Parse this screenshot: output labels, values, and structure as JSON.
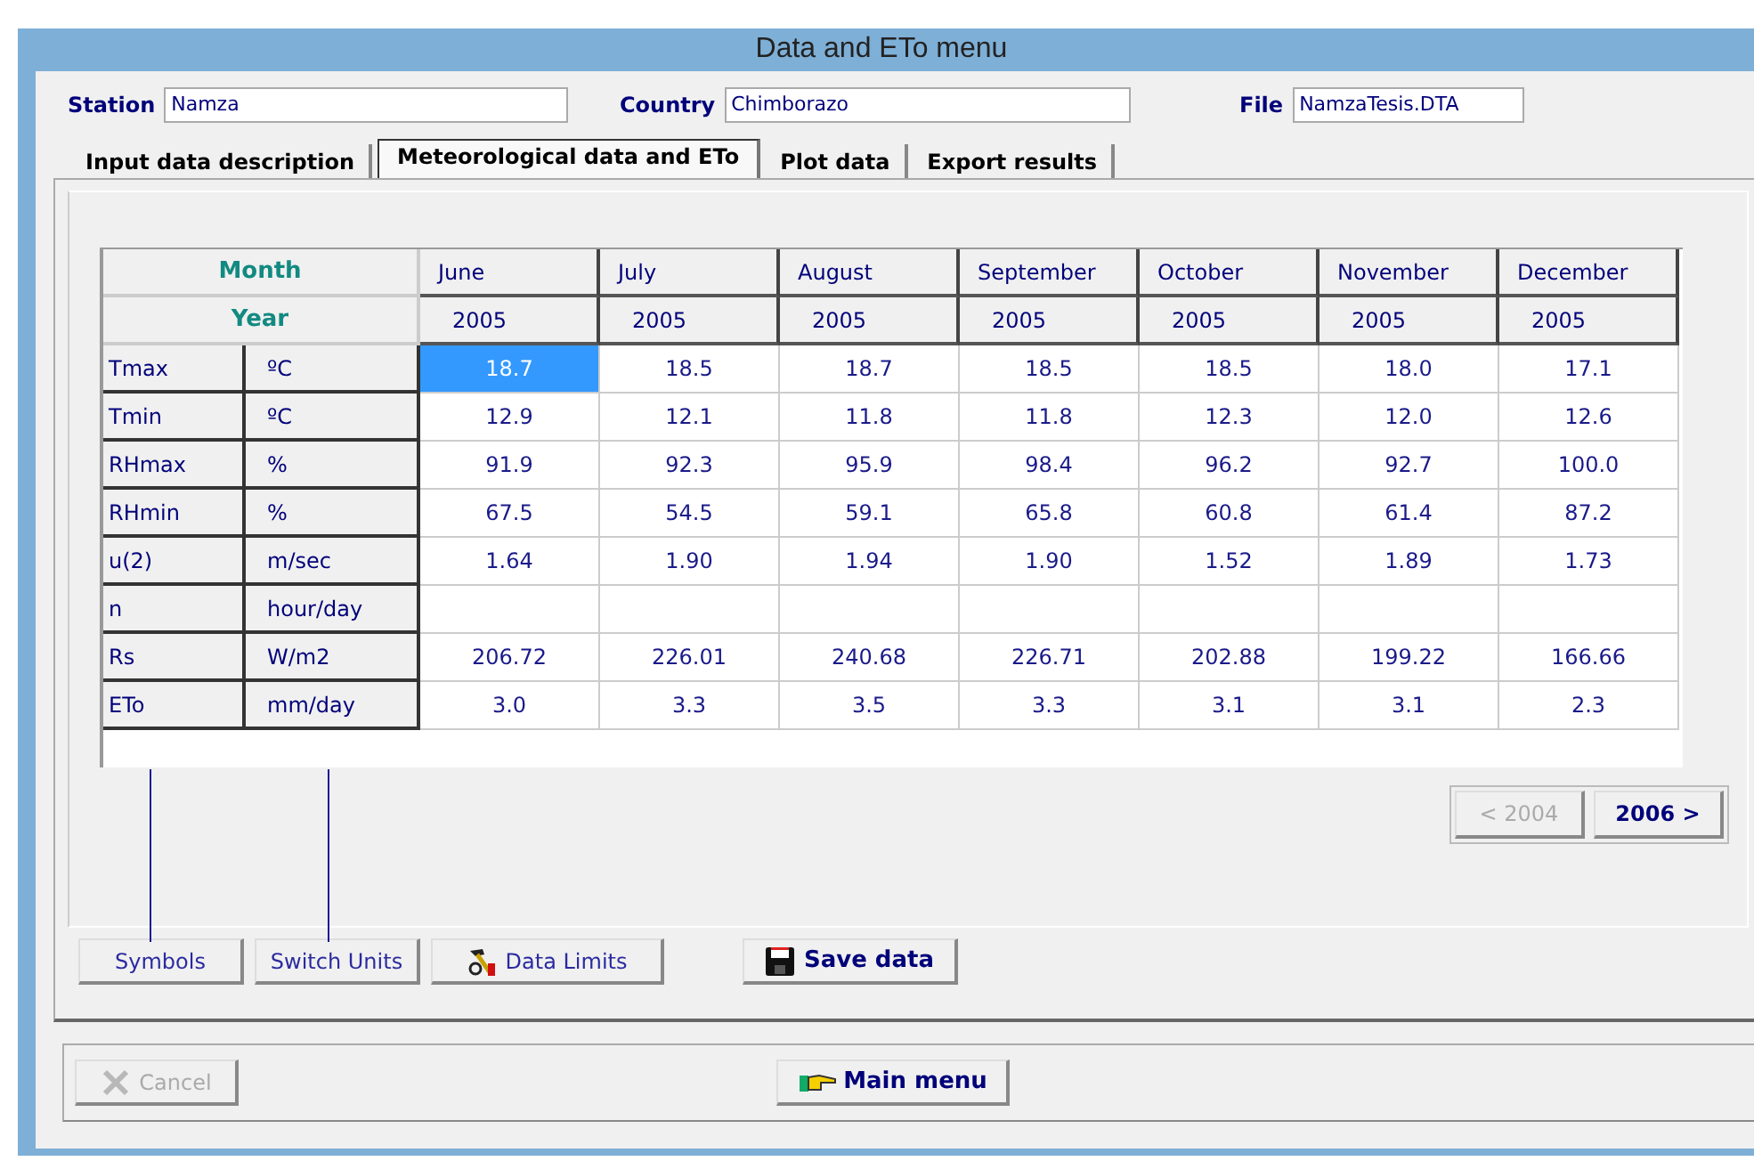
{
  "window": {
    "title": "Data and ETo menu"
  },
  "fields": [
    {
      "label": "Station",
      "value": "Namza"
    },
    {
      "label": "Country",
      "value": "Chimborazo"
    },
    {
      "label": "File",
      "value": "NamzaTesis.DTA"
    }
  ],
  "tabs": [
    {
      "label": "Input data description",
      "selected": false
    },
    {
      "label": "Meteorological data and ETo",
      "selected": true
    },
    {
      "label": "Plot data",
      "selected": false
    },
    {
      "label": "Export results",
      "selected": false
    }
  ],
  "table": {
    "month_label": "Month",
    "year_label": "Year",
    "columns": [
      {
        "month": "June",
        "year": "2005"
      },
      {
        "month": "July",
        "year": "2005"
      },
      {
        "month": "August",
        "year": "2005"
      },
      {
        "month": "September",
        "year": "2005"
      },
      {
        "month": "October",
        "year": "2005"
      },
      {
        "month": "November",
        "year": "2005"
      },
      {
        "month": "December",
        "year": "2005"
      }
    ],
    "rows": [
      {
        "variable": "Tmax",
        "unit": "ºC",
        "cells": [
          {
            "value": "18.7",
            "selected": true
          },
          {
            "value": "18.5",
            "selected": false
          },
          {
            "value": "18.7",
            "selected": false
          },
          {
            "value": "18.5",
            "selected": false
          },
          {
            "value": "18.5",
            "selected": false
          },
          {
            "value": "18.0",
            "selected": false
          },
          {
            "value": "17.1",
            "selected": false
          }
        ]
      },
      {
        "variable": "Tmin",
        "unit": "ºC",
        "cells": [
          {
            "value": "12.9",
            "selected": false
          },
          {
            "value": "12.1",
            "selected": false
          },
          {
            "value": "11.8",
            "selected": false
          },
          {
            "value": "11.8",
            "selected": false
          },
          {
            "value": "12.3",
            "selected": false
          },
          {
            "value": "12.0",
            "selected": false
          },
          {
            "value": "12.6",
            "selected": false
          }
        ]
      },
      {
        "variable": "RHmax",
        "unit": "%",
        "cells": [
          {
            "value": "91.9",
            "selected": false
          },
          {
            "value": "92.3",
            "selected": false
          },
          {
            "value": "95.9",
            "selected": false
          },
          {
            "value": "98.4",
            "selected": false
          },
          {
            "value": "96.2",
            "selected": false
          },
          {
            "value": "92.7",
            "selected": false
          },
          {
            "value": "100.0",
            "selected": false
          }
        ]
      },
      {
        "variable": "RHmin",
        "unit": "%",
        "cells": [
          {
            "value": "67.5",
            "selected": false
          },
          {
            "value": "54.5",
            "selected": false
          },
          {
            "value": "59.1",
            "selected": false
          },
          {
            "value": "65.8",
            "selected": false
          },
          {
            "value": "60.8",
            "selected": false
          },
          {
            "value": "61.4",
            "selected": false
          },
          {
            "value": "87.2",
            "selected": false
          }
        ]
      },
      {
        "variable": "u(2)",
        "unit": "m/sec",
        "cells": [
          {
            "value": "1.64",
            "selected": false
          },
          {
            "value": "1.90",
            "selected": false
          },
          {
            "value": "1.94",
            "selected": false
          },
          {
            "value": "1.90",
            "selected": false
          },
          {
            "value": "1.52",
            "selected": false
          },
          {
            "value": "1.89",
            "selected": false
          },
          {
            "value": "1.73",
            "selected": false
          }
        ]
      },
      {
        "variable": "n",
        "unit": "hour/day",
        "cells": [
          {
            "selected": false
          },
          {
            "selected": false
          },
          {
            "selected": false
          },
          {
            "selected": false
          },
          {
            "selected": false
          },
          {
            "selected": false
          },
          {
            "selected": false
          }
        ]
      },
      {
        "variable": "Rs",
        "unit": "W/m2",
        "cells": [
          {
            "value": "206.72",
            "selected": false
          },
          {
            "value": "226.01",
            "selected": false
          },
          {
            "value": "240.68",
            "selected": false
          },
          {
            "value": "226.71",
            "selected": false
          },
          {
            "value": "202.88",
            "selected": false
          },
          {
            "value": "199.22",
            "selected": false
          },
          {
            "value": "166.66",
            "selected": false
          }
        ]
      },
      {
        "variable": "ETo",
        "unit": "mm/day",
        "cells": [
          {
            "value": "3.0",
            "selected": false
          },
          {
            "value": "3.3",
            "selected": false
          },
          {
            "value": "3.5",
            "selected": false
          },
          {
            "value": "3.3",
            "selected": false
          },
          {
            "value": "3.1",
            "selected": false
          },
          {
            "value": "3.1",
            "selected": false
          },
          {
            "value": "2.3",
            "selected": false
          }
        ]
      }
    ]
  },
  "year_nav": [
    {
      "label": "< 2004",
      "disabled": true
    },
    {
      "label": "2006 >",
      "disabled": false
    }
  ],
  "buttons": [
    {
      "label": "Symbols",
      "kind": "plain"
    },
    {
      "label": "Switch Units",
      "kind": "plain"
    },
    {
      "label": "Data Limits",
      "kind": "limits"
    },
    {
      "label": "Save data",
      "kind": "save"
    }
  ],
  "footer_buttons": [
    {
      "label": "Cancel",
      "kind": "cancel",
      "disabled": true
    },
    {
      "label": "Main menu",
      "kind": "menu",
      "disabled": false
    }
  ]
}
